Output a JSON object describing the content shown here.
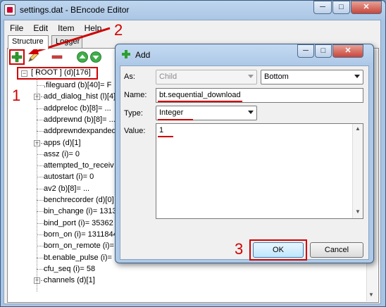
{
  "window": {
    "title": "settings.dat - BEncode Editor",
    "min_label": "─",
    "max_label": "□",
    "close_label": "✕"
  },
  "menu": [
    "File",
    "Edit",
    "Item",
    "Help"
  ],
  "tabs": [
    "Structure",
    "Logger"
  ],
  "tree": {
    "root": "[ ROOT ] (d)[176]",
    "items": [
      {
        "text": ".fileguard (b)[40]= F",
        "exp": false
      },
      {
        "text": "add_dialog_hist (l)[4]",
        "exp": true
      },
      {
        "text": "addpreloc (b)[8]= ...",
        "exp": false
      },
      {
        "text": "addprewnd (b)[8]= ...",
        "exp": false
      },
      {
        "text": "addprewndexpanded",
        "exp": false
      },
      {
        "text": "apps (d)[1]",
        "exp": true
      },
      {
        "text": "assz (i)= 0",
        "exp": false
      },
      {
        "text": "attempted_to_receiv",
        "exp": false
      },
      {
        "text": "autostart (i)= 0",
        "exp": false
      },
      {
        "text": "av2 (b)[8]= ...",
        "exp": false
      },
      {
        "text": "benchrecorder (d)[0]",
        "exp": false
      },
      {
        "text": "bin_change (i)= 1313",
        "exp": false
      },
      {
        "text": "bind_port (i)= 35362",
        "exp": false
      },
      {
        "text": "born_on (i)= 1311844",
        "exp": false
      },
      {
        "text": "born_on_remote (i)=",
        "exp": false
      },
      {
        "text": "bt.enable_pulse (i)=",
        "exp": false
      },
      {
        "text": "cfu_seq (i)= 58",
        "exp": false
      },
      {
        "text": "channels (d)[1]",
        "exp": true
      }
    ]
  },
  "dialog": {
    "title": "Add",
    "as_label": "As:",
    "as_value": "Child",
    "position_value": "Bottom",
    "name_label": "Name:",
    "name_value": "bt.sequential_download",
    "type_label": "Type:",
    "type_value": "Integer",
    "value_label": "Value:",
    "value_value": "1",
    "ok_label": "OK",
    "cancel_label": "Cancel"
  },
  "annotations": {
    "one": "1",
    "two": "2",
    "three": "3"
  },
  "colors": {
    "annotation": "#d00000",
    "add_icon": "#2f9e2f",
    "delete_icon": "#d04040"
  }
}
